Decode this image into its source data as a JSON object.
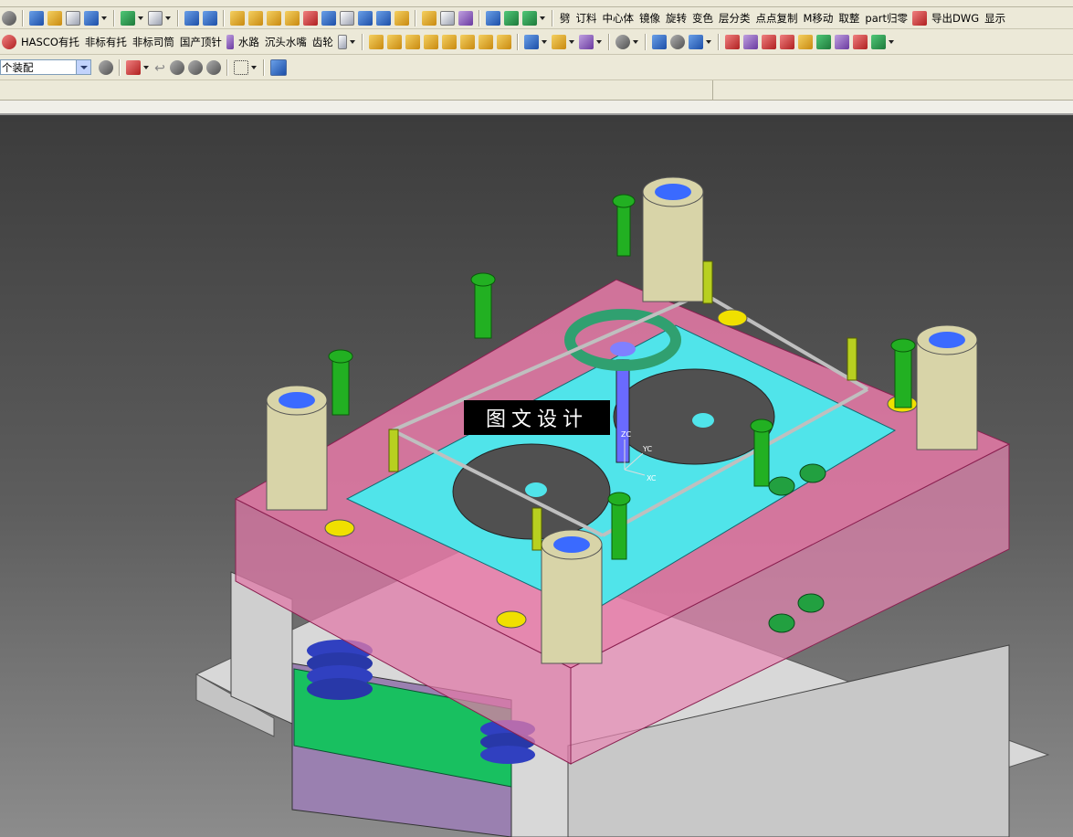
{
  "toolbar_row2": {
    "labels": [
      "劈",
      "订料",
      "中心体",
      "镜像",
      "旋转",
      "变色",
      "层分类",
      "点点复制",
      "M移动",
      "取整",
      "part归零",
      "导出DWG",
      "显示"
    ]
  },
  "toolbar_row3": {
    "labels": [
      "HASCO有托",
      "非标有托",
      "非标司筒",
      "国产顶针",
      "水路",
      "沉头水嘴",
      "齿轮"
    ]
  },
  "toolbar_row4": {
    "selection_filter": "个装配"
  },
  "viewport": {
    "watermark": "图文设计",
    "axis_labels": {
      "z": "ZC",
      "y": "YC",
      "x": "XC"
    }
  },
  "colors": {
    "toolbar_bg": "#ece9d8",
    "mold_plate": "#e87aa8",
    "cavity_insert": "#4de0e8",
    "screw": "#22b022",
    "guide_bushing": "#d8d4a8"
  }
}
